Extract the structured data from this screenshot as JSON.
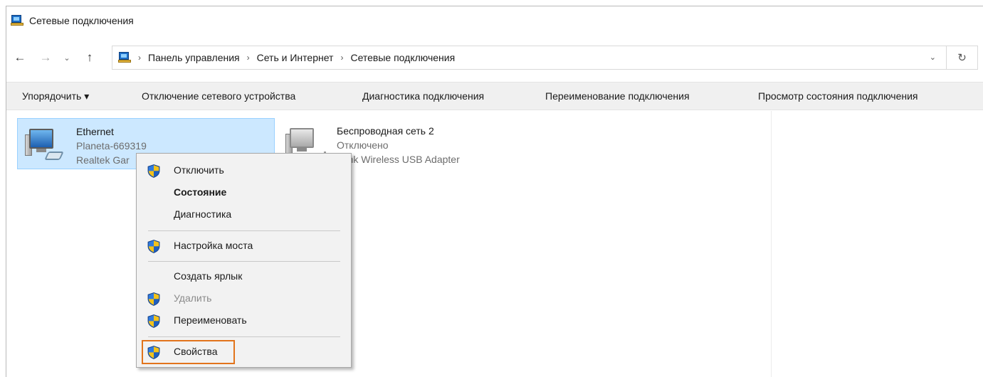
{
  "window": {
    "title": "Сетевые подключения"
  },
  "address": {
    "breadcrumbs": [
      "Панель управления",
      "Сеть и Интернет",
      "Сетевые подключения"
    ]
  },
  "commands": {
    "organize": "Упорядочить ▾",
    "disable_device": "Отключение сетевого устройства",
    "diagnose": "Диагностика подключения",
    "rename": "Переименование подключения",
    "view_status": "Просмотр состояния подключения"
  },
  "connections": [
    {
      "name": "Ethernet",
      "status": "Planeta-669319",
      "adapter": "Realtek Gar",
      "selected": true
    },
    {
      "name": "Беспроводная сеть 2",
      "status": "Отключено",
      "adapter": "-Link Wireless USB Adapter",
      "selected": false
    }
  ],
  "context_menu": {
    "items": [
      {
        "label": "Отключить",
        "shield": true
      },
      {
        "label": "Состояние",
        "bold": true
      },
      {
        "label": "Диагностика"
      },
      {
        "label": "Настройка моста",
        "shield": true
      },
      {
        "label": "Создать ярлык"
      },
      {
        "label": "Удалить",
        "shield": true,
        "disabled": true
      },
      {
        "label": "Переименовать",
        "shield": true
      },
      {
        "label": "Свойства",
        "shield": true,
        "highlighted": true
      }
    ]
  },
  "colors": {
    "selection_bg": "#cce8ff",
    "selection_border": "#99d1ff",
    "highlight_border": "#e2741c",
    "command_bar_bg": "#f0f0f0"
  }
}
